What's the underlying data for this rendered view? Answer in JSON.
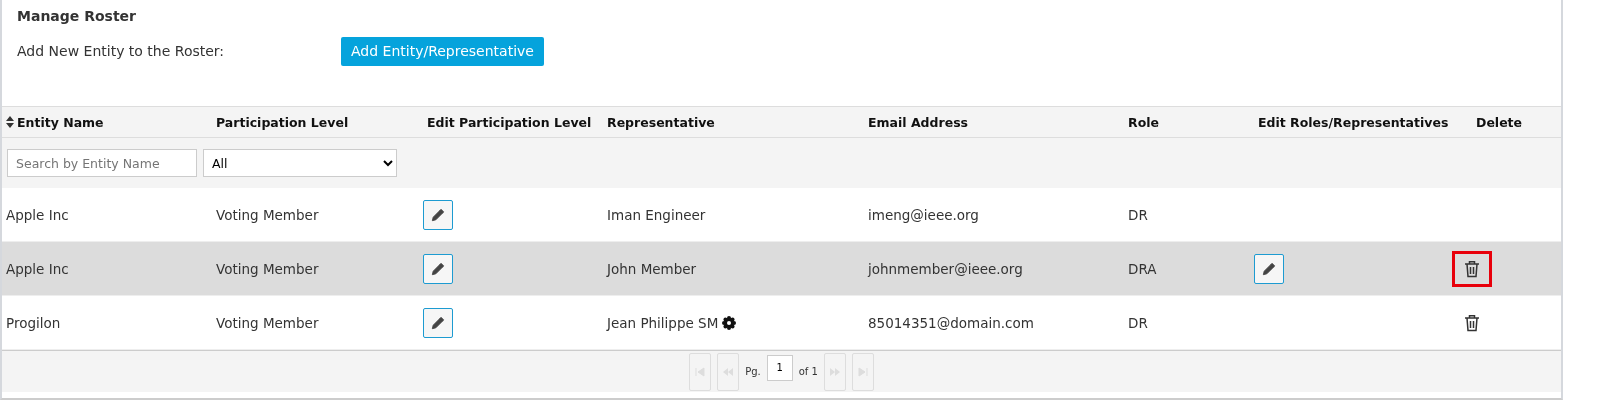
{
  "title": "Manage Roster",
  "add": {
    "label": "Add New Entity to the Roster:",
    "button": "Add Entity/Representative"
  },
  "columns": [
    {
      "label": "Entity Name",
      "sortable": true
    },
    {
      "label": "Participation Level",
      "sortable": false
    },
    {
      "label": "Edit Participation Level",
      "sortable": false
    },
    {
      "label": "Representative",
      "sortable": false
    },
    {
      "label": "Email Address",
      "sortable": false
    },
    {
      "label": "Role",
      "sortable": false
    },
    {
      "label": "Edit Roles/Representatives",
      "sortable": false
    },
    {
      "label": "Delete",
      "sortable": false
    }
  ],
  "filters": {
    "search_placeholder": "Search by Entity Name",
    "level_value": "All"
  },
  "rows": [
    {
      "entity": "Apple Inc",
      "level": "Voting Member",
      "representative": "Iman Engineer",
      "badge": false,
      "email": "imeng@ieee.org",
      "role": "DR",
      "edit_roles": false,
      "deletable": false,
      "selected": false,
      "delete_highlighted": false
    },
    {
      "entity": "Apple Inc",
      "level": "Voting Member",
      "representative": "John Member",
      "badge": false,
      "email": "johnmember@ieee.org",
      "role": "DRA",
      "edit_roles": true,
      "deletable": true,
      "selected": true,
      "delete_highlighted": true
    },
    {
      "entity": "Progilon",
      "level": "Voting Member",
      "representative": "Jean Philippe SM",
      "badge": true,
      "email": "85014351@domain.com",
      "role": "DR",
      "edit_roles": false,
      "deletable": true,
      "selected": false,
      "delete_highlighted": false
    }
  ],
  "pager": {
    "prefix": "Pg.",
    "page": "1",
    "suffix": "of 1"
  }
}
